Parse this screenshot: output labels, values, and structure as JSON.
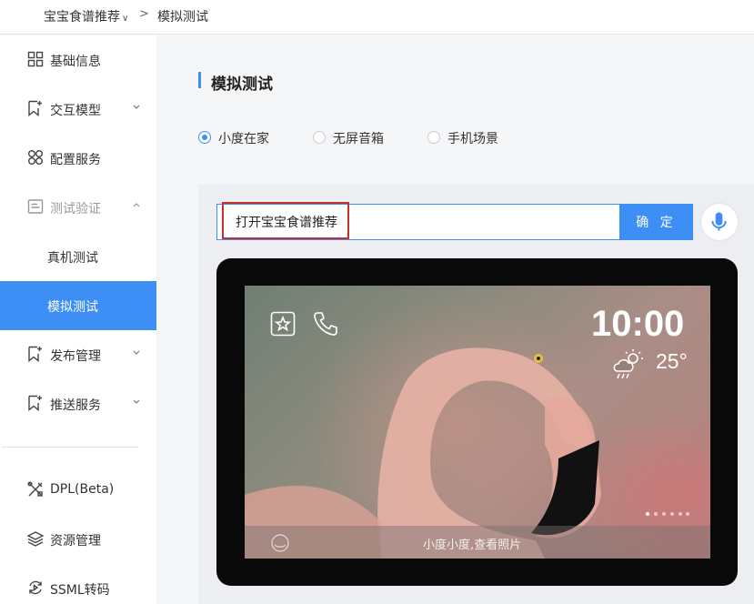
{
  "breadcrumb": {
    "app": "宝宝食谱推荐",
    "separator": ">",
    "current": "模拟测试"
  },
  "sidebar": {
    "items": [
      {
        "label": "基础信息",
        "icon": "grid-icon"
      },
      {
        "label": "交互模型",
        "icon": "bookmark-plus-icon"
      },
      {
        "label": "配置服务",
        "icon": "clover-icon"
      },
      {
        "label": "测试验证",
        "icon": "document-icon"
      },
      {
        "label": "真机测试"
      },
      {
        "label": "模拟测试"
      },
      {
        "label": "发布管理",
        "icon": "bookmark-plus-icon"
      },
      {
        "label": "推送服务",
        "icon": "bookmark-plus-icon"
      },
      {
        "label": "DPL(Beta)",
        "icon": "tools-icon"
      },
      {
        "label": "资源管理",
        "icon": "layers-icon"
      },
      {
        "label": "SSML转码",
        "icon": "convert-icon"
      }
    ]
  },
  "main": {
    "title": "模拟测试",
    "device_types": [
      "小度在家",
      "无屏音箱",
      "手机场景"
    ],
    "selected_device": "小度在家",
    "input_value": "打开宝宝食谱推荐",
    "confirm_label": "确 定"
  },
  "screen": {
    "time": "10:00",
    "temperature": "25°",
    "caption": "小度小度,查看照片"
  },
  "colors": {
    "accent": "#3d8ff5",
    "highlight": "#c9302c"
  }
}
